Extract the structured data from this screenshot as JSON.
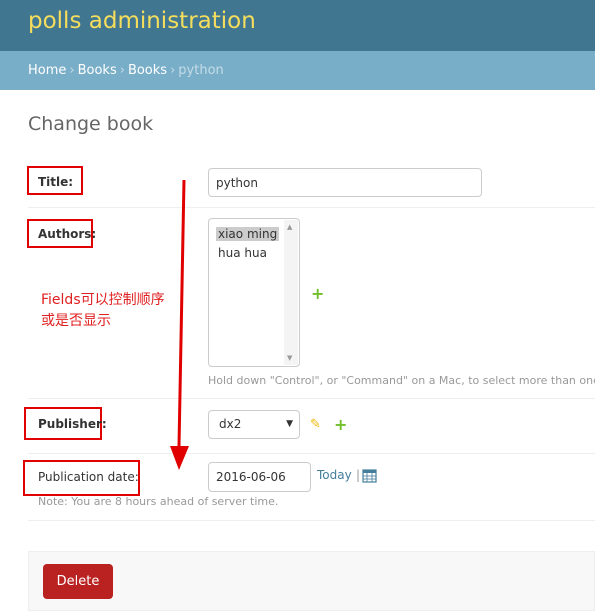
{
  "header": {
    "brand": "polls administration"
  },
  "breadcrumbs": {
    "home": "Home",
    "app": "Books",
    "model": "Books",
    "current": "python",
    "separator": "›"
  },
  "page": {
    "title": "Change book"
  },
  "form": {
    "title_label": "Title:",
    "title_value": "python",
    "authors_label": "Authors:",
    "authors_options": [
      {
        "label": "xiao ming",
        "selected": true
      },
      {
        "label": "hua hua",
        "selected": false
      }
    ],
    "authors_help": "Hold down \"Control\", or \"Command\" on a Mac, to select more than one.",
    "publisher_label": "Publisher:",
    "publisher_value": "dx2",
    "pubdate_label": "Publication date:",
    "pubdate_value": "2016-06-06",
    "today_link": "Today",
    "pipe": "|",
    "timezone_note": "Note: You are 8 hours ahead of server time."
  },
  "annotation": {
    "line1": "Fields可以控制顺序",
    "line2": "或是否显示"
  },
  "actions": {
    "delete_label": "Delete"
  },
  "icons": {
    "add": "add-icon",
    "edit": "pencil-icon",
    "calendar": "calendar-icon"
  },
  "colors": {
    "header_bg": "#417690",
    "brand": "#f5dd5d",
    "breadcrumbs_bg": "#79aec8",
    "delete_bg": "#ba2121",
    "annotation": "#e00000"
  }
}
